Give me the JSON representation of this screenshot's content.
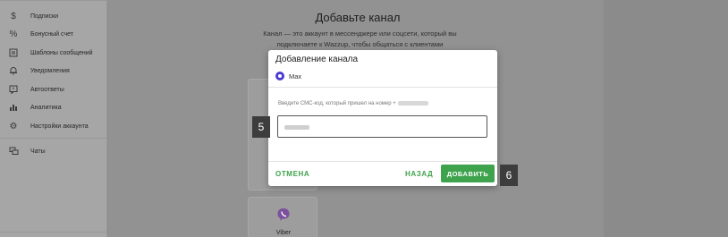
{
  "sidebar": {
    "items": [
      {
        "label": "Подписки",
        "icon": "dollar-icon"
      },
      {
        "label": "Бонусный счет",
        "icon": "percent-icon"
      },
      {
        "label": "Шаблоны сообщений",
        "icon": "document-icon"
      },
      {
        "label": "Уведомления",
        "icon": "bell-icon"
      },
      {
        "label": "Автоответы",
        "icon": "autoreply-icon"
      },
      {
        "label": "Аналитика",
        "icon": "bar-chart-icon"
      },
      {
        "label": "Настройки аккаунта",
        "icon": "gear-icon"
      },
      {
        "label": "Чаты",
        "icon": "chat-icon"
      }
    ]
  },
  "main": {
    "title": "Добавьте канал",
    "subtitle": "Канал — это аккаунт в мессенджере или соцсети, который вы подключаете к Wazzup, чтобы общаться с клиентами",
    "cards": [
      {
        "label": "Viber",
        "icon": "viber-icon"
      }
    ]
  },
  "modal": {
    "title": "Добавление канала",
    "channel_name": "Max",
    "hint": "Введите СМС-код, который пришел на номер +",
    "cancel_label": "ОТМЕНА",
    "back_label": "НАЗАД",
    "add_label": "ДОБАВИТЬ"
  },
  "badges": {
    "step5": "5",
    "step6": "6"
  },
  "colors": {
    "accent": "#3fa34d",
    "channel_icon": "#4a3cd1",
    "viber": "#7b519d"
  }
}
